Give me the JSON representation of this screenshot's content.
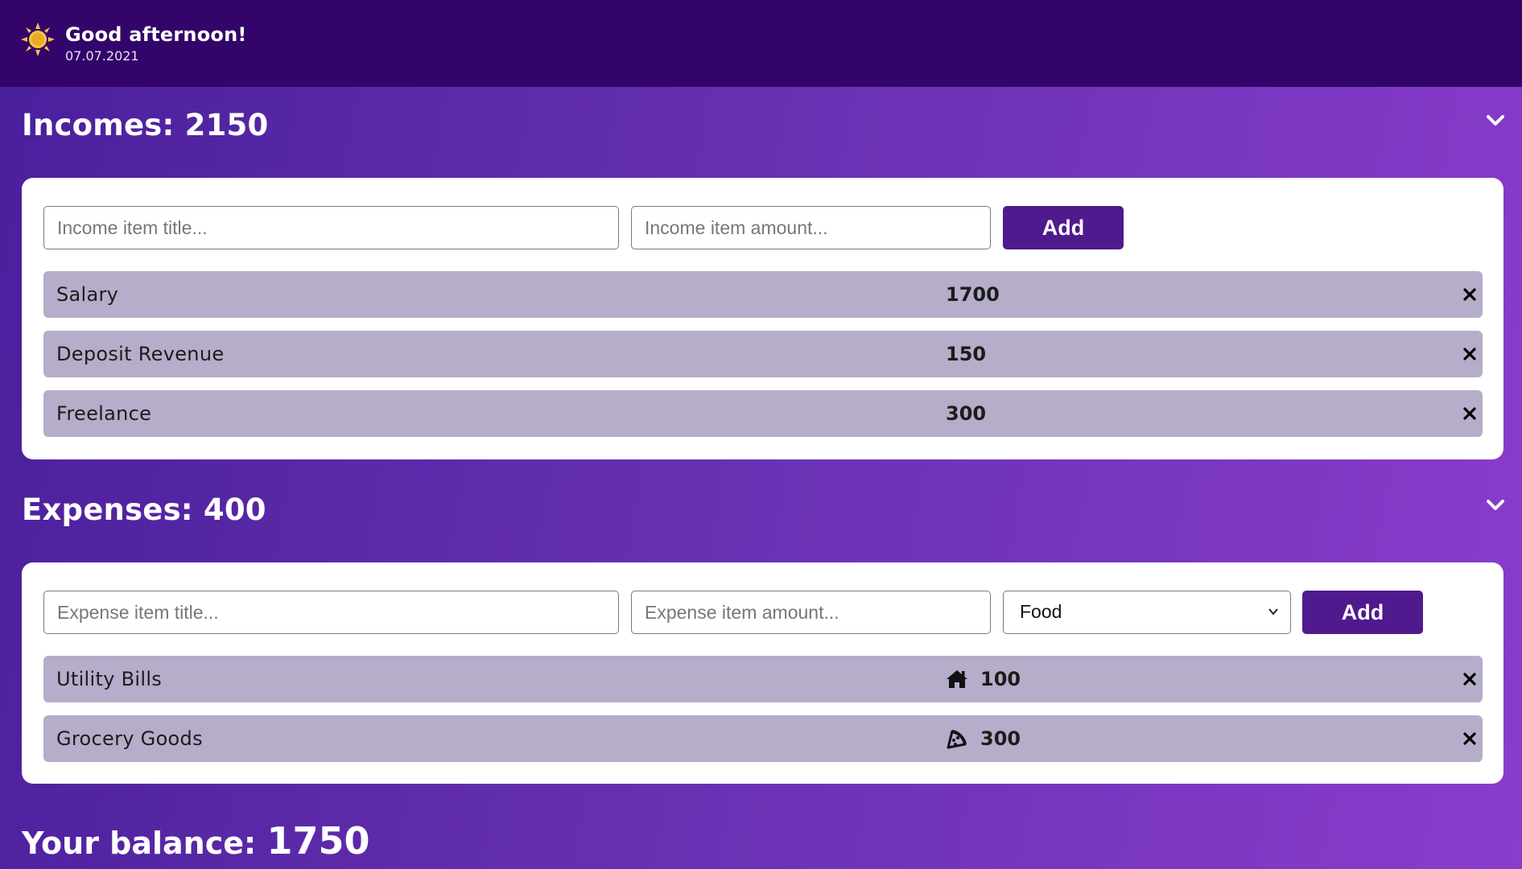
{
  "header": {
    "greeting": "Good afternoon!",
    "date": "07.07.2021",
    "icon": "sun-icon"
  },
  "incomes": {
    "label": "Incomes:",
    "total": "2150",
    "title_placeholder": "Income item title...",
    "amount_placeholder": "Income item amount...",
    "add_label": "Add",
    "items": [
      {
        "title": "Salary",
        "amount": "1700"
      },
      {
        "title": "Deposit Revenue",
        "amount": "150"
      },
      {
        "title": "Freelance",
        "amount": "300"
      }
    ]
  },
  "expenses": {
    "label": "Expenses:",
    "total": "400",
    "title_placeholder": "Expense item title...",
    "amount_placeholder": "Expense item amount...",
    "category_selected": "Food",
    "add_label": "Add",
    "items": [
      {
        "title": "Utility Bills",
        "amount": "100",
        "icon": "home-icon"
      },
      {
        "title": "Grocery Goods",
        "amount": "300",
        "icon": "pizza-icon"
      }
    ]
  },
  "balance": {
    "label": "Your balance:",
    "value": "1750"
  },
  "colors": {
    "topbar": "#33056a",
    "button": "#4f1a8e",
    "row": "#b5adc9",
    "sun": "#f6c645"
  }
}
